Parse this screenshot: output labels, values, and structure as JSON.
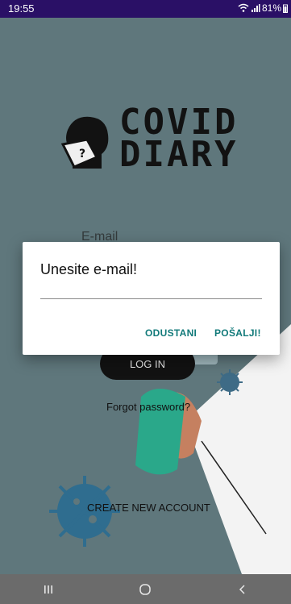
{
  "status": {
    "time": "19:55",
    "battery": "81%"
  },
  "logo": {
    "line1": "COVID",
    "line2": "DIARY"
  },
  "form": {
    "email_label": "E-mail",
    "login_label": "LOG IN",
    "forgot_label": "Forgot password?",
    "create_label": "CREATE NEW ACCOUNT"
  },
  "dialog": {
    "title": "Unesite e-mail!",
    "input_value": "",
    "cancel_label": "ODUSTANI",
    "send_label": "POŠALJI!"
  },
  "nav": {
    "recent": "recent-apps-icon",
    "home": "home-icon",
    "back": "back-icon"
  },
  "colors": {
    "status_bar": "#2a1066",
    "background": "#5f777c",
    "accent": "#127a7a",
    "nav_bar": "#6b6b6b"
  }
}
